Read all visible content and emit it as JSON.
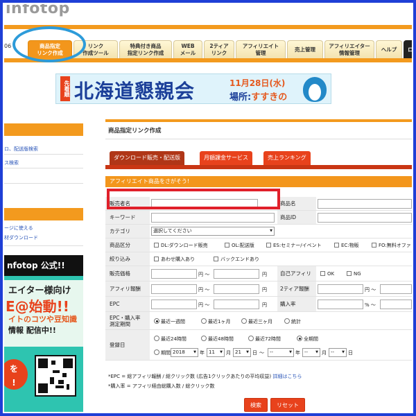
{
  "header": {
    "logo_text": "infotop"
  },
  "nav": {
    "left_cut": "06",
    "tabs": [
      {
        "label": "商品指定\nリンク作成",
        "active": true
      },
      {
        "label": "リンク\n作成ツール"
      },
      {
        "label": "特典付き商品\n指定リンク作成"
      },
      {
        "label": "WEB\nメール"
      },
      {
        "label": "2ティア\nリンク"
      },
      {
        "label": "アフィリエイト\n管理"
      },
      {
        "label": "売上管理"
      },
      {
        "label": "アフィリエイター\n情報管理"
      },
      {
        "label": "ヘルプ"
      },
      {
        "label": "ロ"
      }
    ]
  },
  "banner": {
    "tag": "先着順",
    "title": "北海道懇親会",
    "date": "11月28日(水)",
    "place_label": "場所:",
    "place_value": "すすきの"
  },
  "sidebar": {
    "links": [
      "ロ、配送版検索",
      "ス検索",
      "ージに使える",
      "材ダウンロード"
    ],
    "promo": {
      "head": "nfotop 公式!!",
      "line1": "エイター様向け",
      "line2": "E@始動!!",
      "line3": "イトのコツや豆知識",
      "line4": "情報 配信中!!",
      "bubble": "を\n!"
    }
  },
  "main": {
    "page_title": "商品指定リンク作成",
    "subtabs": [
      "ダウンロード販売・配送版",
      "月額課金サービス",
      "売上ランキング"
    ],
    "section_title": "アフィリエイト商品をさがそう!",
    "fields": {
      "seller_name": "販売者名",
      "product_name": "商品名",
      "keyword": "キーワード",
      "product_id": "商品ID",
      "category": "カテゴリ",
      "category_value": "選択してください",
      "product_type": "商品区分",
      "type_options": [
        "DL:ダウンロード販売",
        "OL:配送版",
        "ES:セミナー/イベント",
        "EC:物販",
        "FO:無料オファ"
      ],
      "filter": "絞り込み",
      "filter_options": [
        "あわせ購入あり",
        "バックエンドあり"
      ],
      "price": "販売価格",
      "self_affiliate": "自己アフィリ",
      "self_options": [
        "OK",
        "NG"
      ],
      "affiliate_reward": "アフィリ報酬",
      "tier2_reward": "2ティア報酬",
      "epc": "EPC",
      "purchase_rate": "購入率",
      "epc_period": "EPC・購入率\n測定期間",
      "epc_period_options": [
        "最近一週間",
        "最近1ヶ月",
        "最近三ヶ月",
        "統計"
      ],
      "reg_date": "登録日",
      "reg_options": [
        "最近24時間",
        "最近48時間",
        "最近72時間",
        "全期間"
      ],
      "period_label": "期間",
      "year": "2018",
      "month": "11",
      "day": "21",
      "empty_select": "--",
      "unit_year": "年",
      "unit_month": "月",
      "unit_day": "日",
      "tilde": "～",
      "yen": "円",
      "yen_tilde": "円 ～",
      "pct_tilde": "% ～"
    },
    "notes": {
      "note1": "*EPC = 総アフィリ報酬 / 総クリック数 (広告1クリックあたりの平均収益)",
      "note1_link": "詳細はこちら",
      "note2": "*購入率 = アフィリ経由総購入数 / 総クリック数"
    },
    "buttons": {
      "search": "検索",
      "reset": "リセット"
    }
  }
}
